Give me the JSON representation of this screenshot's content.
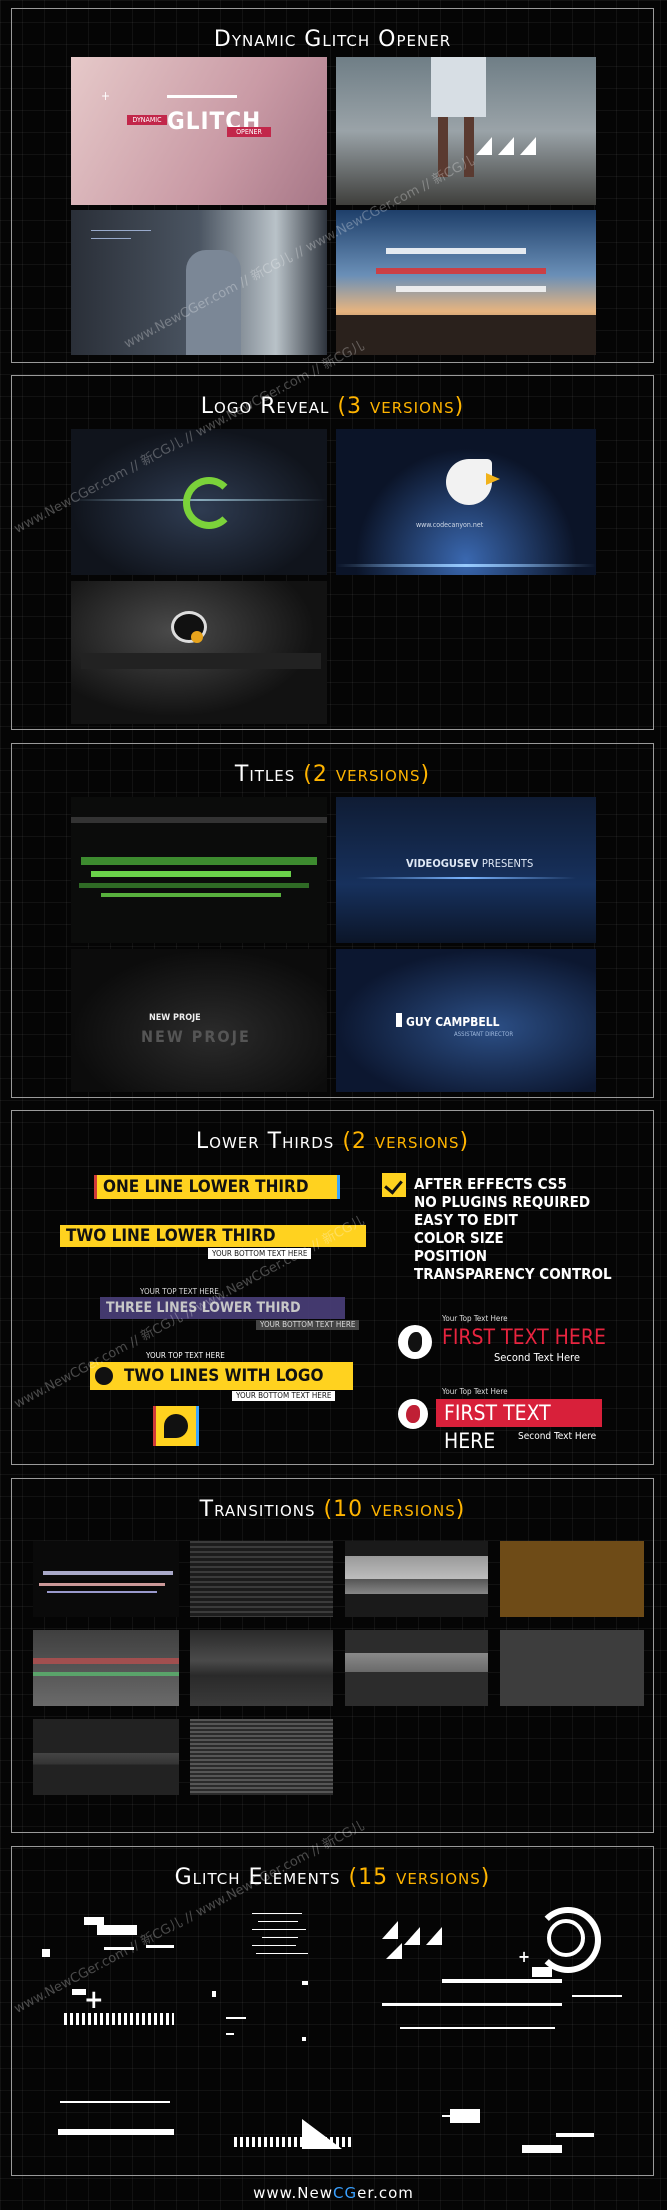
{
  "sections": {
    "dynamic_glitch": {
      "title": "Dynamic Glitch Opener"
    },
    "logo_reveal": {
      "title": "Logo Reveal",
      "count": "(3 versions)"
    },
    "titles": {
      "title": "Titles",
      "count": "(2 versions)"
    },
    "lower_thirds": {
      "title": "Lower Thirds",
      "count": "(2 versions)"
    },
    "transitions": {
      "title": "Transitions",
      "count": "(10 versions)"
    },
    "glitch_elements": {
      "title": "Glitch Elements",
      "count": "(15 versions)"
    }
  },
  "thumb_text": {
    "dynamic_label": "DYNAMIC",
    "glitch_word": "GLITCH",
    "opener_word": "OPENER",
    "logo_url": "www.codecanyon.net",
    "videogusev": "VIDEOGUSEV",
    "presents": "PRESENTS",
    "new_project": "NEW PROJE",
    "guy_campbell": "GUY CAMPBELL",
    "director": "ASSISTANT DIRECTOR"
  },
  "lower_thirds": {
    "one_line": "ONE LINE LOWER THIRD",
    "two_line": "TWO LINE LOWER THIRD",
    "bottom_text": "YOUR BOTTOM TEXT HERE",
    "three_lines": "THREE LINES LOWER THIRD",
    "top_text": "YOUR TOP TEXT HERE",
    "two_lines_logo": "TWO LINES WITH LOGO",
    "features": [
      "AFTER EFFECTS CS5",
      "NO PLUGINS REQUIRED",
      "EASY TO EDIT",
      "COLOR  SIZE",
      "POSITION",
      "TRANSPARENCY CONTROL"
    ],
    "red_top": "Your Top Text Here",
    "red_main_1": "FIRST TEXT HERE",
    "red_sub_1": "Second Text Here",
    "red_top_2": "Your Top Text Here",
    "red_main_2": "FIRST TEXT HERE",
    "red_sub_2": "Second Text Here"
  },
  "watermark": "www.NewCGer.com // 新CG儿 // www.NewCGer.com // 新CG儿",
  "footer": {
    "pre": "www.New",
    "accent": "CG",
    "post": "er.com"
  },
  "colors": {
    "accent": "#ffb400",
    "lower_third_yellow": "#ffd21f",
    "lower_third_red": "#d8203a",
    "footer_blue": "#39a0ff"
  }
}
